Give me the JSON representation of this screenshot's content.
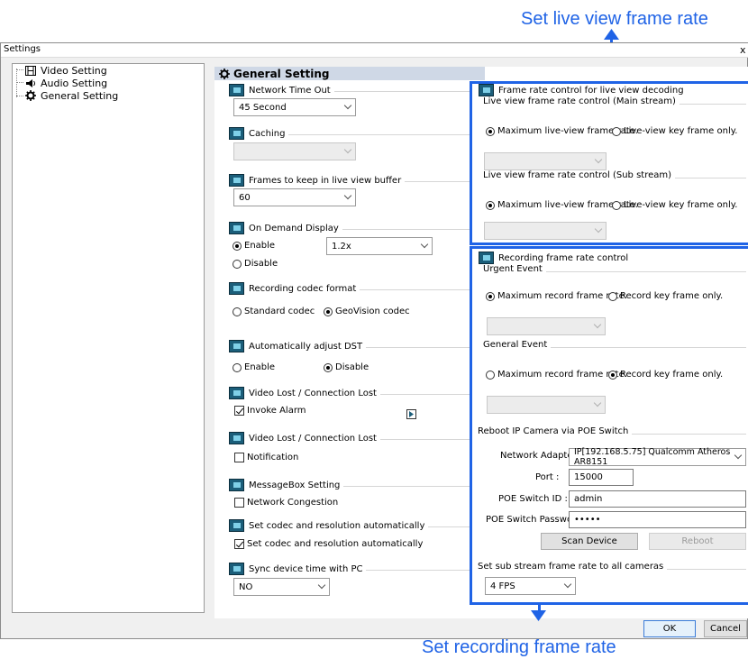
{
  "callouts": {
    "top": "Set live view frame rate",
    "bottom": "Set recording frame rate"
  },
  "window": {
    "title": "Settings",
    "close": "x"
  },
  "tree": {
    "items": [
      {
        "label": "Video Setting"
      },
      {
        "label": "Audio Setting"
      },
      {
        "label": "General Setting"
      }
    ]
  },
  "general": {
    "title": "General Setting",
    "network_timeout": {
      "label": "Network Time Out",
      "value": "45 Second"
    },
    "caching": {
      "label": "Caching",
      "value": ""
    },
    "frames_buffer": {
      "label": "Frames to keep in live view buffer",
      "value": "60"
    },
    "on_demand": {
      "label": "On Demand Display",
      "enable": "Enable",
      "disable": "Disable",
      "value": "1.2x"
    },
    "rec_codec": {
      "label": "Recording codec format",
      "standard": "Standard codec",
      "geovision": "GeoVision codec"
    },
    "dst": {
      "label": "Automatically adjust DST",
      "enable": "Enable",
      "disable": "Disable"
    },
    "video_lost1": {
      "label": "Video Lost / Connection Lost",
      "check": "Invoke Alarm"
    },
    "video_lost2": {
      "label": "Video Lost / Connection Lost",
      "check": "Notification"
    },
    "msgbox": {
      "label": "MessageBox Setting",
      "check": "Network Congestion"
    },
    "set_codec": {
      "label": "Set codec and resolution automatically",
      "check": "Set codec and resolution automatically"
    },
    "sync_time": {
      "label": "Sync device time with PC",
      "value": "NO"
    }
  },
  "live": {
    "title": "Frame rate control for live view decoding",
    "main": {
      "label": "Live view frame rate control (Main stream)",
      "max": "Maximum live-view frame rate.",
      "key": "Live-view key frame only."
    },
    "sub": {
      "label": "Live view frame rate control (Sub stream)",
      "max": "Maximum live-view frame rate.",
      "key": "Live-view key frame only."
    }
  },
  "recording": {
    "title": "Recording frame rate control",
    "urgent": {
      "label": "Urgent Event",
      "max": "Maximum record frame rate.",
      "key": "Record key frame only."
    },
    "general": {
      "label": "General Event",
      "max": "Maximum record frame rate.",
      "key": "Record key frame only."
    }
  },
  "poe": {
    "label": "Reboot IP Camera via POE Switch",
    "adapter_label": "Network Adapter :",
    "adapter_value": "IP[192.168.5.75] Qualcomm Atheros AR8151",
    "port_label": "Port :",
    "port_value": "15000",
    "switch_id_label": "POE Switch ID :",
    "switch_id_value": "admin",
    "password_label": "POE Switch Password :",
    "password_value": "•••••",
    "scan": "Scan Device",
    "reboot": "Reboot"
  },
  "sub_stream": {
    "label": "Set sub stream frame rate to all cameras",
    "value": "4 FPS"
  },
  "footer": {
    "ok": "OK",
    "cancel": "Cancel"
  },
  "colors": {
    "accent": "#1f63e6",
    "group_icon": "#1b5e7a"
  }
}
